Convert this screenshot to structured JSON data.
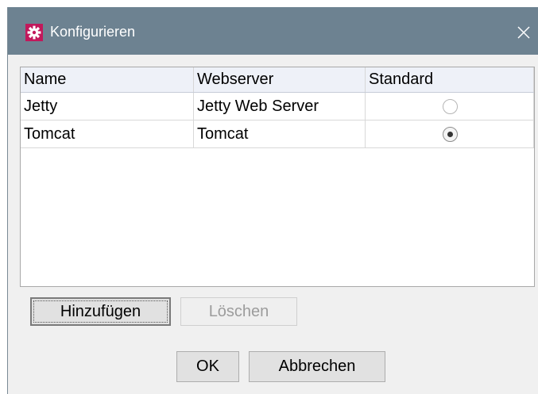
{
  "window": {
    "title": "Konfigurieren",
    "titlebar_color": "#6d8291",
    "icon": "gear-icon",
    "icon_color": "#c2185b"
  },
  "table": {
    "columns": [
      "Name",
      "Webserver",
      "Standard"
    ],
    "rows": [
      {
        "name": "Jetty",
        "webserver": "Jetty Web Server",
        "standard": false
      },
      {
        "name": "Tomcat",
        "webserver": "Tomcat",
        "standard": true
      }
    ]
  },
  "buttons": {
    "add": "Hinzufügen",
    "delete": "Löschen",
    "ok": "OK",
    "cancel": "Abbrechen"
  }
}
